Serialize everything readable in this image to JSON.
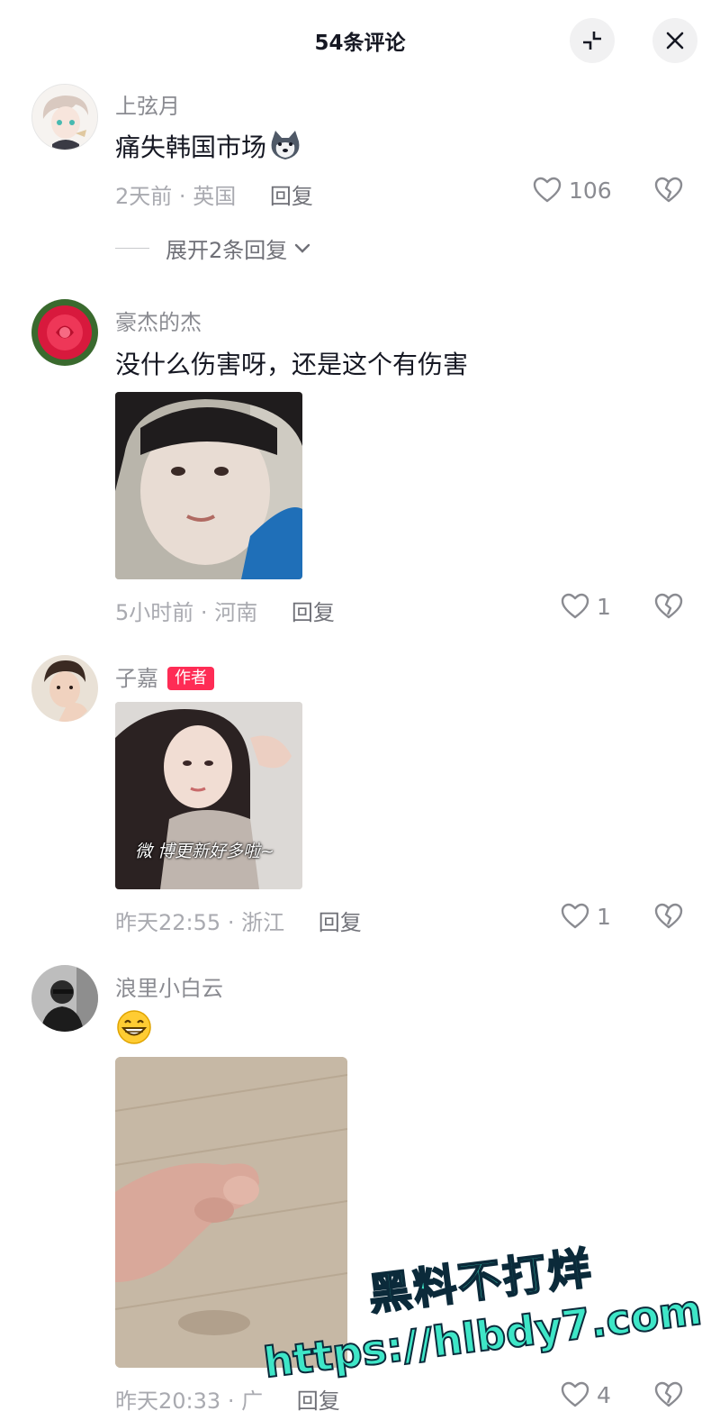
{
  "header": {
    "title": "54条评论",
    "collapse_icon": "collapse-icon",
    "close_icon": "close-icon"
  },
  "colors": {
    "accent": "#fe2c55",
    "muted_text": "#a9aab0",
    "watermark": "#3ee6c7"
  },
  "comments": [
    {
      "username": "上弦月",
      "text": "痛失韩国市场",
      "emoji": "husky-dog-emoji",
      "time": "2天前",
      "location": "英国",
      "reply_label": "回复",
      "likes": "106",
      "expand_label": "展开2条回复"
    },
    {
      "username": "豪杰的杰",
      "text": "没什么伤害呀，还是这个有伤害",
      "time": "5小时前",
      "location": "河南",
      "reply_label": "回复",
      "likes": "1"
    },
    {
      "username": "子嘉",
      "badge": "作者",
      "image_caption": "微 博更新好多啦~",
      "time": "昨天22:55",
      "location": "浙江",
      "reply_label": "回复",
      "likes": "1"
    },
    {
      "username": "浪里小白云",
      "emoji": "grinning-face-emoji",
      "time": "昨天20:33",
      "location": "广",
      "reply_label": "回复",
      "likes": "4"
    }
  ],
  "separator": "·",
  "watermark": {
    "line1": "黑料不打烊",
    "line2": "https://hlbdy7.com"
  }
}
